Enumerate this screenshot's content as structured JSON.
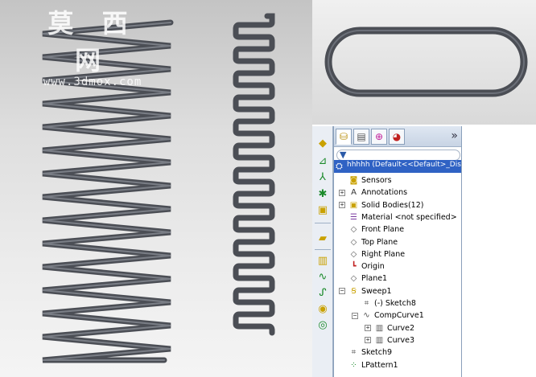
{
  "watermark": {
    "cn": "莫 西 网",
    "url": "www.3dmox.com"
  },
  "feature_manager": {
    "more_label": "»",
    "top_item": "hhhhh  (Default<<Default>_Displ",
    "items": [
      {
        "label": "Sensors",
        "icon": "sensors-icon"
      },
      {
        "label": "Annotations",
        "icon": "annotations-icon"
      },
      {
        "label": "Solid Bodies(12)",
        "icon": "solid-bodies-icon"
      },
      {
        "label": "Material <not specified>",
        "icon": "material-icon"
      },
      {
        "label": "Front Plane",
        "icon": "plane-icon"
      },
      {
        "label": "Top Plane",
        "icon": "plane-icon"
      },
      {
        "label": "Right Plane",
        "icon": "plane-icon"
      },
      {
        "label": "Origin",
        "icon": "origin-icon"
      },
      {
        "label": "Plane1",
        "icon": "plane-icon"
      },
      {
        "label": "Sweep1",
        "icon": "sweep-icon"
      },
      {
        "label": "(-) Sketch8",
        "icon": "sketch-icon"
      },
      {
        "label": "CompCurve1",
        "icon": "composite-curve-icon"
      },
      {
        "label": "Curve2",
        "icon": "curve-icon"
      },
      {
        "label": "Curve3",
        "icon": "curve-icon"
      },
      {
        "label": "Sketch9",
        "icon": "sketch-icon"
      },
      {
        "label": "LPattern1",
        "icon": "linear-pattern-icon"
      }
    ]
  },
  "colors": {
    "selection": "#2f62c4",
    "spring": "#4b4e55",
    "spring_highlight": "#7a7e86"
  }
}
